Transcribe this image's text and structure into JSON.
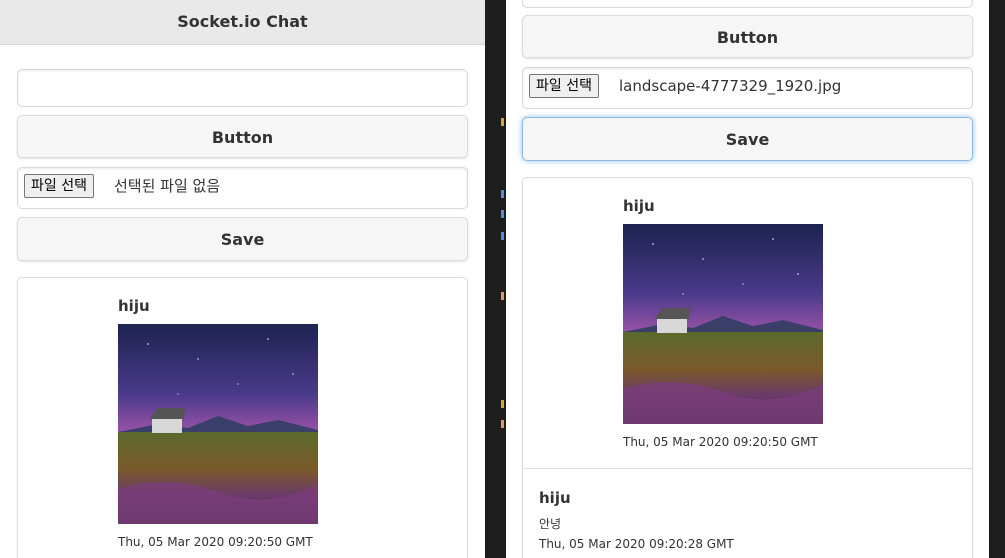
{
  "left": {
    "header_title": "Socket.io Chat",
    "message_input_value": "",
    "button_label": "Button",
    "file_choose_label": "파일 선택",
    "file_status": "선택된 파일 없음",
    "save_label": "Save",
    "messages": [
      {
        "user": "hiju",
        "image": "landscape",
        "time": "Thu, 05 Mar 2020 09:20:50 GMT"
      }
    ]
  },
  "right": {
    "button_label": "Button",
    "file_choose_label": "파일 선택",
    "file_status": "landscape-4777329_1920.jpg",
    "save_label": "Save",
    "messages": [
      {
        "user": "hiju",
        "image": "landscape",
        "time": "Thu, 05 Mar 2020 09:20:50 GMT"
      },
      {
        "user": "hiju",
        "text": "안녕",
        "time": "Thu, 05 Mar 2020 09:20:28 GMT"
      }
    ]
  },
  "colors": {
    "focus_ring": "#8fb8e4",
    "editor_background": "#1e1e1e"
  }
}
